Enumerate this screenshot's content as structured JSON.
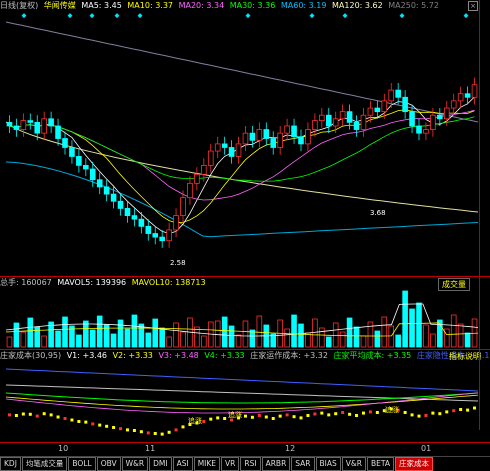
{
  "main": {
    "period": "日线(复权)",
    "stock_name": "华闻传媒",
    "ma": [
      {
        "label": "MA5: 3.45",
        "color": "#ffffff"
      },
      {
        "label": "MA10: 3.37",
        "color": "#ffff00"
      },
      {
        "label": "MA20: 3.34",
        "color": "#ff66ff"
      },
      {
        "label": "MA30: 3.36",
        "color": "#00ff00"
      },
      {
        "label": "MA60: 3.19",
        "color": "#00c0ff"
      },
      {
        "label": "MA120: 3.62",
        "color": "#ffffc0"
      },
      {
        "label": "MA250: 5.72",
        "color": "#808080"
      }
    ],
    "high_label": "3.68",
    "low_label": "2.58"
  },
  "volume": {
    "label": "总手: 160067",
    "mavol5": "MAVOL5: 139396",
    "mavol10": "MAVOL10: 138713",
    "button": "成交量"
  },
  "cost": {
    "label": "庄家成本(30,95)",
    "v1": "V1: +3.46",
    "v2": "V2: +3.33",
    "v3": "V3: +3.48",
    "v4": "V4: +3.33",
    "op_cost": "庄家运作成本: +3.32",
    "avg_cost": "庄家平均成本: +3.35",
    "hidden_cost": "庄家隐性成本: +3.19",
    "button": "指标说明",
    "notes": [
      "追涨",
      "追涨",
      "追涨"
    ]
  },
  "xaxis": [
    "10",
    "11",
    "12",
    "01"
  ],
  "tabs": [
    "KDJ",
    "均笔成交量",
    "BOLL",
    "OBV",
    "W&R",
    "DMI",
    "ASI",
    "MIKE",
    "VR",
    "RSI",
    "ARBR",
    "SAR",
    "BIAS",
    "V&R",
    "BETA",
    "庄家成本"
  ],
  "active_tab": "庄家成本",
  "chart_data": {
    "type": "line",
    "candles_close": [
      3.22,
      3.2,
      3.25,
      3.24,
      3.18,
      3.26,
      3.22,
      3.15,
      3.1,
      3.05,
      3.0,
      2.98,
      2.92,
      2.88,
      2.84,
      2.8,
      2.76,
      2.72,
      2.7,
      2.66,
      2.62,
      2.6,
      2.58,
      2.64,
      2.72,
      2.82,
      2.9,
      2.95,
      3.0,
      3.08,
      3.12,
      3.1,
      3.05,
      3.12,
      3.18,
      3.14,
      3.2,
      3.15,
      3.1,
      3.18,
      3.22,
      3.16,
      3.12,
      3.2,
      3.25,
      3.28,
      3.22,
      3.26,
      3.3,
      3.24,
      3.2,
      3.28,
      3.32,
      3.3,
      3.36,
      3.42,
      3.38,
      3.3,
      3.22,
      3.18,
      3.2,
      3.28,
      3.26,
      3.32,
      3.36,
      3.4,
      3.38,
      3.45
    ]
  }
}
